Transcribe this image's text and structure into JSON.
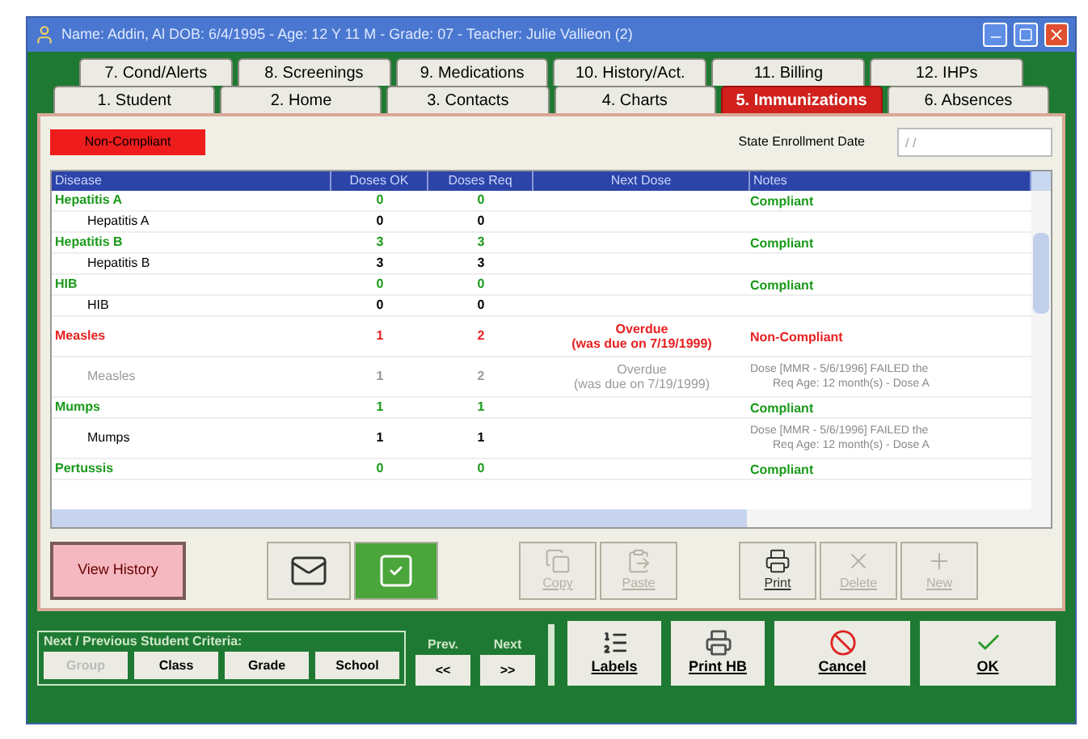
{
  "window": {
    "title": "Name: Addin, Al  DOB: 6/4/1995 - Age: 12 Y 11 M - Grade: 07 - Teacher: Julie Vallieon (2)"
  },
  "tabs_back": [
    {
      "label": "7. Cond/Alerts",
      "selected": false
    },
    {
      "label": "8. Screenings",
      "selected": false
    },
    {
      "label": "9. Medications",
      "selected": false
    },
    {
      "label": "10. History/Act.",
      "selected": false
    },
    {
      "label": "11. Billing",
      "selected": false
    },
    {
      "label": "12. IHPs",
      "selected": false
    }
  ],
  "tabs_front": [
    {
      "label": "1. Student",
      "selected": false
    },
    {
      "label": "2. Home",
      "selected": false
    },
    {
      "label": "3. Contacts",
      "selected": false
    },
    {
      "label": "4. Charts",
      "selected": false
    },
    {
      "label": "5. Immunizations",
      "selected": true
    },
    {
      "label": "6. Absences",
      "selected": false
    }
  ],
  "compliance_badge": "Non-Compliant",
  "state_enrollment_date": {
    "label": "State Enrollment Date",
    "value": "/ /"
  },
  "table": {
    "columns": [
      "Disease",
      "Doses OK",
      "Doses Req",
      "Next Dose",
      "Notes"
    ],
    "rows": [
      {
        "kind": "group",
        "non_compliant": false,
        "disease": "Hepatitis A",
        "doses_ok": "0",
        "doses_req": "0",
        "next_dose": [],
        "notes": [
          "Compliant"
        ]
      },
      {
        "kind": "dose",
        "greyed": false,
        "disease": "Hepatitis A",
        "doses_ok": "0",
        "doses_req": "0",
        "next_dose": [],
        "notes": []
      },
      {
        "kind": "group",
        "non_compliant": false,
        "disease": "Hepatitis B",
        "doses_ok": "3",
        "doses_req": "3",
        "next_dose": [],
        "notes": [
          "Compliant"
        ]
      },
      {
        "kind": "dose",
        "greyed": false,
        "disease": "Hepatitis B",
        "doses_ok": "3",
        "doses_req": "3",
        "next_dose": [],
        "notes": []
      },
      {
        "kind": "group",
        "non_compliant": false,
        "disease": "HIB",
        "doses_ok": "0",
        "doses_req": "0",
        "next_dose": [],
        "notes": [
          "Compliant"
        ]
      },
      {
        "kind": "dose",
        "greyed": false,
        "disease": "HIB",
        "doses_ok": "0",
        "doses_req": "0",
        "next_dose": [],
        "notes": []
      },
      {
        "kind": "group",
        "non_compliant": true,
        "disease": "Measles",
        "doses_ok": "1",
        "doses_req": "2",
        "next_dose": [
          "Overdue",
          "(was due on 7/19/1999)"
        ],
        "notes": [
          "Non-Compliant"
        ]
      },
      {
        "kind": "dose",
        "greyed": true,
        "disease": "Measles",
        "doses_ok": "1",
        "doses_req": "2",
        "next_dose": [
          "Overdue",
          "(was due on 7/19/1999)"
        ],
        "notes": [
          "Dose [MMR - 5/6/1996] FAILED the",
          "Req Age: 12 month(s) - Dose A"
        ]
      },
      {
        "kind": "group",
        "non_compliant": false,
        "disease": "Mumps",
        "doses_ok": "1",
        "doses_req": "1",
        "next_dose": [],
        "notes": [
          "Compliant"
        ]
      },
      {
        "kind": "dose",
        "greyed": false,
        "disease": "Mumps",
        "doses_ok": "1",
        "doses_req": "1",
        "next_dose": [],
        "notes": [
          "Dose [MMR - 5/6/1996] FAILED the",
          "Req Age: 12 month(s) - Dose A"
        ]
      },
      {
        "kind": "group",
        "non_compliant": false,
        "disease": "Pertussis",
        "doses_ok": "0",
        "doses_req": "0",
        "next_dose": [],
        "notes": [
          "Compliant"
        ]
      }
    ]
  },
  "action_buttons": [
    {
      "kind": "history",
      "label": "View History",
      "disabled": false
    },
    {
      "kind": "envelope",
      "disabled": false
    },
    {
      "kind": "checkmark",
      "disabled": false
    },
    {
      "kind": "copy",
      "label": "Copy",
      "disabled": true
    },
    {
      "kind": "paste",
      "label": "Paste",
      "disabled": true
    },
    {
      "kind": "print",
      "label": "Print",
      "disabled": false
    },
    {
      "kind": "delete",
      "label": "Delete",
      "disabled": true
    },
    {
      "kind": "new",
      "label": "New",
      "disabled": true
    }
  ],
  "criteria": {
    "title": "Next / Previous Student Criteria:",
    "buttons": [
      {
        "label": "Group",
        "disabled": true
      },
      {
        "label": "Class",
        "disabled": false
      },
      {
        "label": "Grade",
        "disabled": false
      },
      {
        "label": "School",
        "disabled": false
      }
    ]
  },
  "navigation": [
    {
      "heading": "Prev.",
      "label": "<<"
    },
    {
      "heading": "Next",
      "label": ">>"
    }
  ],
  "footer_buttons": [
    {
      "kind": "labels",
      "label": "Labels"
    },
    {
      "kind": "print",
      "label": "Print HB"
    },
    {
      "kind": "cancel",
      "label": "Cancel"
    },
    {
      "kind": "ok",
      "label": "OK"
    }
  ]
}
